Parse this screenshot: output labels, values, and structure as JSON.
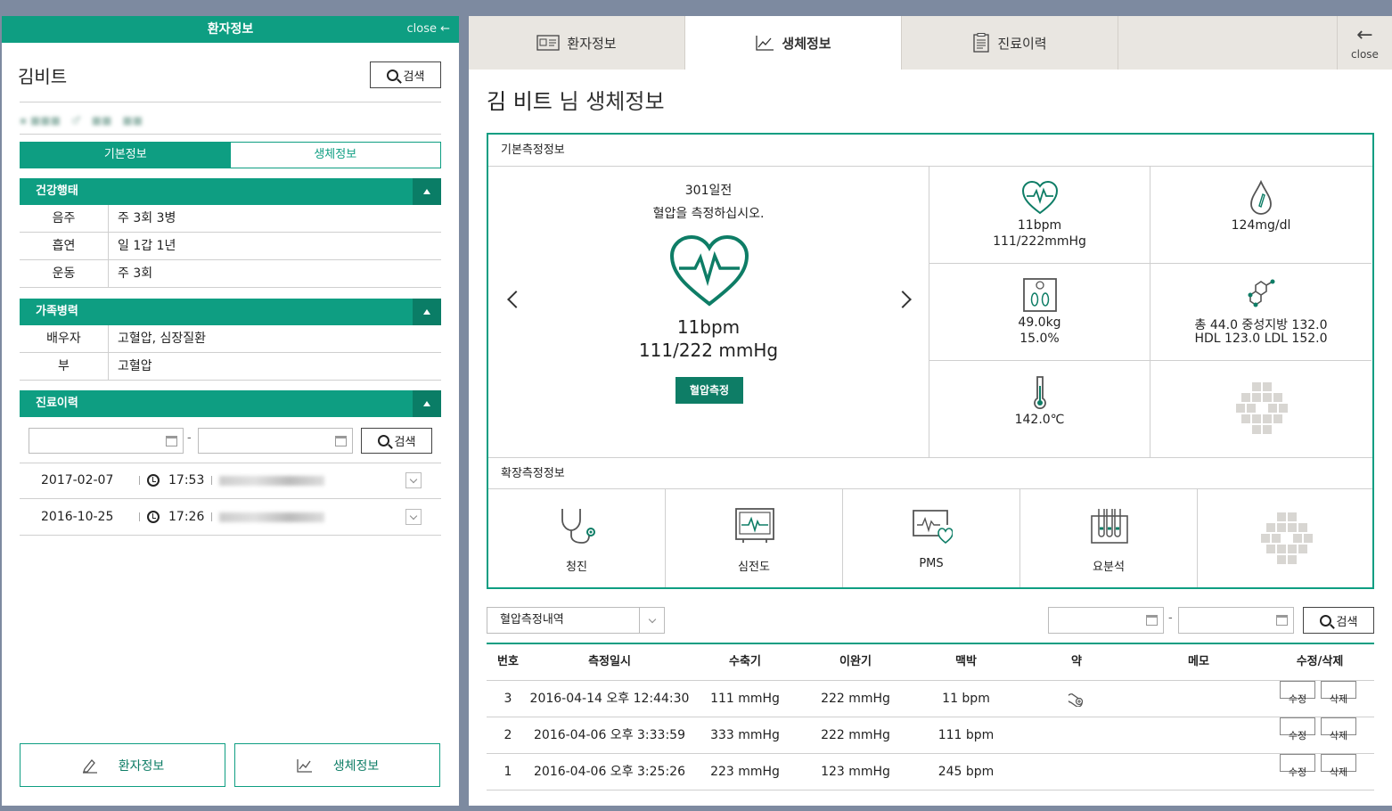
{
  "left": {
    "header_title": "환자정보",
    "close_label": "close",
    "patient_name": "김비트",
    "search_label": "검색",
    "tabs": [
      "기본정보",
      "생체정보"
    ],
    "sections": {
      "health": {
        "title": "건강행태",
        "rows": [
          {
            "k": "음주",
            "v": "주 3회 3병"
          },
          {
            "k": "흡연",
            "v": "일 1갑 1년"
          },
          {
            "k": "운동",
            "v": "주 3회"
          }
        ]
      },
      "family": {
        "title": "가족병력",
        "rows": [
          {
            "k": "배우자",
            "v": "고혈압, 심장질환"
          },
          {
            "k": "부",
            "v": "고혈압"
          }
        ]
      },
      "history": {
        "title": "진료이력",
        "date_sep": "-",
        "search_label": "검색",
        "rows": [
          {
            "date": "2017-02-07",
            "time": "17:53"
          },
          {
            "date": "2016-10-25",
            "time": "17:26"
          }
        ]
      }
    },
    "bottom_buttons": [
      "환자정보",
      "생체정보"
    ]
  },
  "right": {
    "tabs": [
      "환자정보",
      "생체정보",
      "진료이력"
    ],
    "close_label": "close",
    "title_name": "김 비트",
    "title_suffix": " 님 생체정보",
    "basic_label": "기본측정정보",
    "main_card": {
      "days": "301일전",
      "message": "혈압을 측정하십시오.",
      "bpm": "11bpm",
      "bp": "111/222 mmHg",
      "button": "혈압측정"
    },
    "cells": {
      "heart": {
        "l1": "11bpm",
        "l2": "111/222mmHg"
      },
      "glucose": {
        "l1": "124mg/dl"
      },
      "weight": {
        "l1": "49.0kg",
        "l2": "15.0%"
      },
      "chol": {
        "l1": "총 44.0  중성지방 132.0",
        "l2": "HDL 123.0  LDL 152.0"
      },
      "temp": {
        "l1": "142.0℃"
      }
    },
    "ext_label": "확장측정정보",
    "ext_cells": [
      "청진",
      "심전도",
      "PMS",
      "요분석"
    ],
    "select_value": "혈압측정내역",
    "date_sep": "-",
    "search_label": "검색",
    "table": {
      "headers": [
        "번호",
        "측정일시",
        "수축기",
        "이완기",
        "맥박",
        "약",
        "메모",
        "수정/삭제"
      ],
      "rows": [
        {
          "no": "3",
          "dt": "2016-04-14 오후 12:44:30",
          "sys": "111 mmHg",
          "dia": "222 mmHg",
          "pulse": "11 bpm"
        },
        {
          "no": "2",
          "dt": "2016-04-06 오후 3:33:59",
          "sys": "333 mmHg",
          "dia": "222 mmHg",
          "pulse": "111 bpm"
        },
        {
          "no": "1",
          "dt": "2016-04-06 오후 3:25:26",
          "sys": "223 mmHg",
          "dia": "123 mmHg",
          "pulse": "245 bpm"
        }
      ],
      "edit_label": "수정",
      "delete_label": "삭제"
    }
  },
  "colors": {
    "accent": "#0e9e82",
    "accent_dark": "#0e7d66",
    "tabbar": "#e9e6e1",
    "frame": "#7d8aa0"
  }
}
